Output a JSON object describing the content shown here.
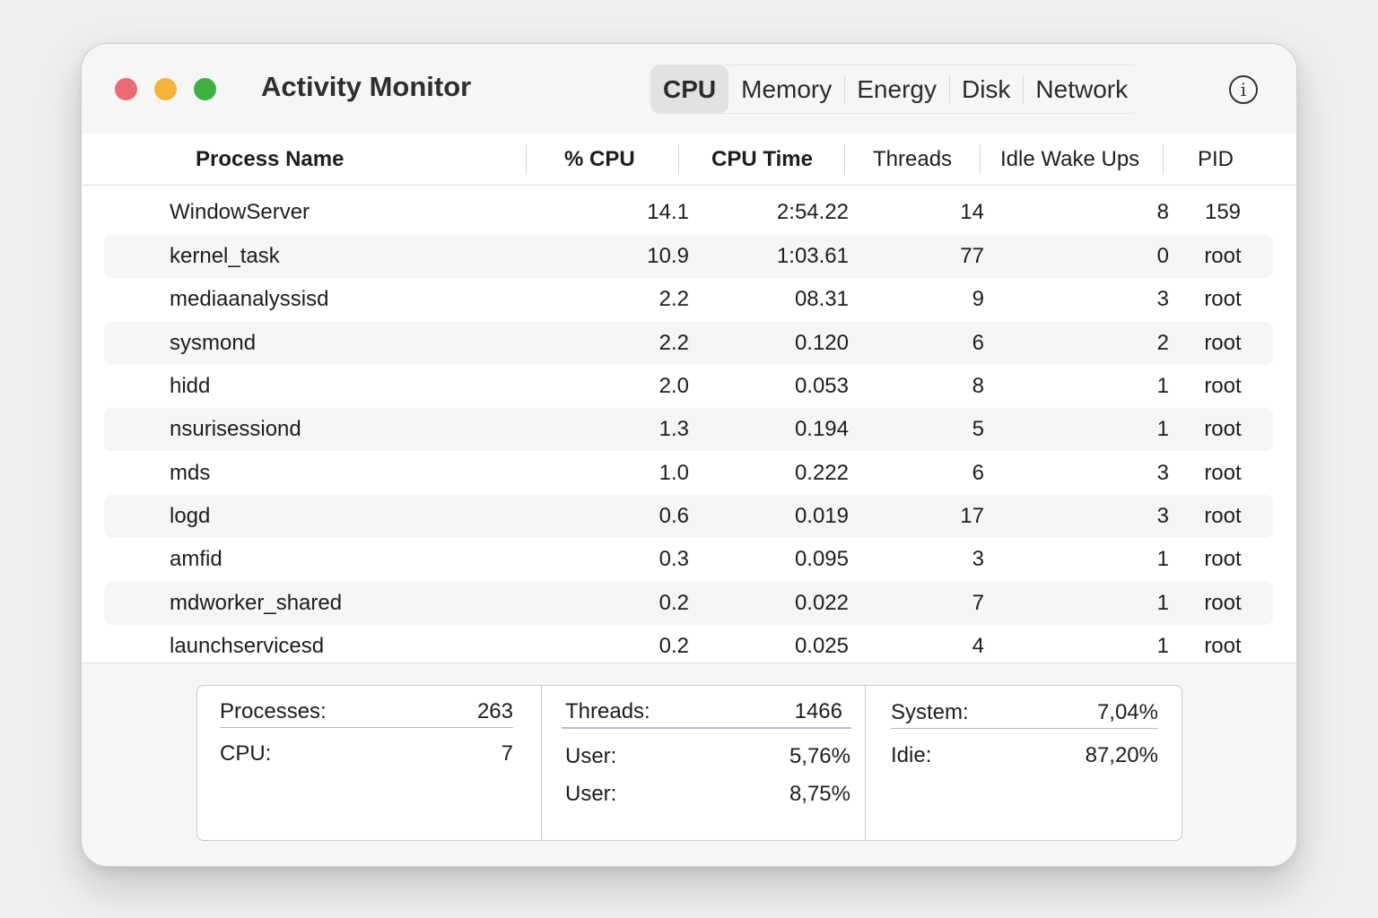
{
  "window": {
    "title": "Activity Monitor",
    "tabs": [
      {
        "label": "CPU",
        "active": true
      },
      {
        "label": "Memory",
        "active": false
      },
      {
        "label": "Energy",
        "active": false
      },
      {
        "label": "Disk",
        "active": false
      },
      {
        "label": "Network",
        "active": false
      }
    ],
    "info_glyph": "i"
  },
  "table": {
    "columns": [
      "Process Name",
      "% CPU",
      "CPU Time",
      "Threads",
      "Idle Wake Ups",
      "PID"
    ],
    "rows": [
      {
        "name": "WindowServer",
        "cpu": "14.1",
        "time": "2:54.22",
        "threads": "14",
        "idle": "8",
        "pid": "159"
      },
      {
        "name": "kernel_task",
        "cpu": "10.9",
        "time": "1:03.61",
        "threads": "77",
        "idle": "0",
        "pid": "root"
      },
      {
        "name": "mediaanalyssisd",
        "cpu": "2.2",
        "time": "08.31",
        "threads": "9",
        "idle": "3",
        "pid": "root"
      },
      {
        "name": "sysmond",
        "cpu": "2.2",
        "time": "0.120",
        "threads": "6",
        "idle": "2",
        "pid": "root"
      },
      {
        "name": "hidd",
        "cpu": "2.0",
        "time": "0.053",
        "threads": "8",
        "idle": "1",
        "pid": "root"
      },
      {
        "name": "nsurisessiond",
        "cpu": "1.3",
        "time": "0.194",
        "threads": "5",
        "idle": "1",
        "pid": "root"
      },
      {
        "name": "mds",
        "cpu": "1.0",
        "time": "0.222",
        "threads": "6",
        "idle": "3",
        "pid": "root"
      },
      {
        "name": "logd",
        "cpu": "0.6",
        "time": "0.019",
        "threads": "17",
        "idle": "3",
        "pid": "root"
      },
      {
        "name": "amfid",
        "cpu": "0.3",
        "time": "0.095",
        "threads": "3",
        "idle": "1",
        "pid": "root"
      },
      {
        "name": "mdworker_shared",
        "cpu": "0.2",
        "time": "0.022",
        "threads": "7",
        "idle": "1",
        "pid": "root"
      },
      {
        "name": "launchservicesd",
        "cpu": "0.2",
        "time": "0.025",
        "threads": "4",
        "idle": "1",
        "pid": "root"
      }
    ]
  },
  "stats": {
    "processes_label": "Processes:",
    "processes_value": "263",
    "cpu_label": "CPU:",
    "cpu_value": "7",
    "threads_label": "Threads:",
    "threads_value": "1466",
    "user1_label": "User:",
    "user1_value": "5,76%",
    "user2_label": "User:",
    "user2_value": "8,75%",
    "system_label": "System:",
    "system_value": "7,04%",
    "idle_label": "Idie:",
    "idle_value": "87,20%"
  },
  "colors": {
    "close": "#ee6a75",
    "minimize": "#f6b33c",
    "zoom": "#3fae43",
    "active_tab": "#e2e2e2"
  }
}
